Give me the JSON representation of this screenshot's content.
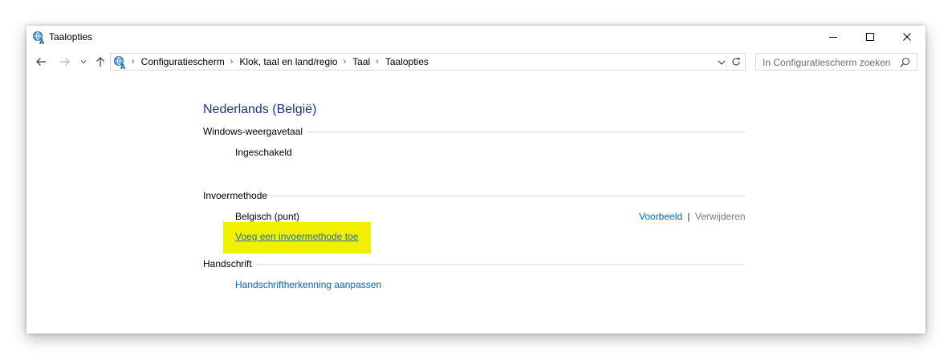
{
  "window": {
    "title": "Taalopties"
  },
  "toolbar": {
    "breadcrumbs": [
      "Configuratiescherm",
      "Klok, taal en land/regio",
      "Taal",
      "Taalopties"
    ],
    "search_placeholder": "In Configuratiescherm zoeken"
  },
  "main": {
    "language_title": "Nederlands (België)",
    "display_language": {
      "label": "Windows-weergavetaal",
      "status": "Ingeschakeld"
    },
    "input_method": {
      "label": "Invoermethode",
      "keyboard": "Belgisch (punt)",
      "preview_link": "Voorbeeld",
      "separator": "|",
      "remove_link": "Verwijderen",
      "add_link": "Voeg een invoermethode toe"
    },
    "handwriting": {
      "label": "Handschrift",
      "customize_link": "Handschriftherkenning aanpassen"
    }
  },
  "colors": {
    "title_blue": "#1e3287",
    "link_blue": "#0066cc",
    "highlight_yellow": "#f0f000"
  },
  "icons": [
    "language-icon",
    "back-arrow-icon",
    "forward-arrow-icon",
    "recent-chevron-icon",
    "up-arrow-icon",
    "chevron-right-icon",
    "chevron-down-icon",
    "refresh-icon",
    "search-icon",
    "minimize-icon",
    "maximize-icon",
    "close-icon"
  ]
}
